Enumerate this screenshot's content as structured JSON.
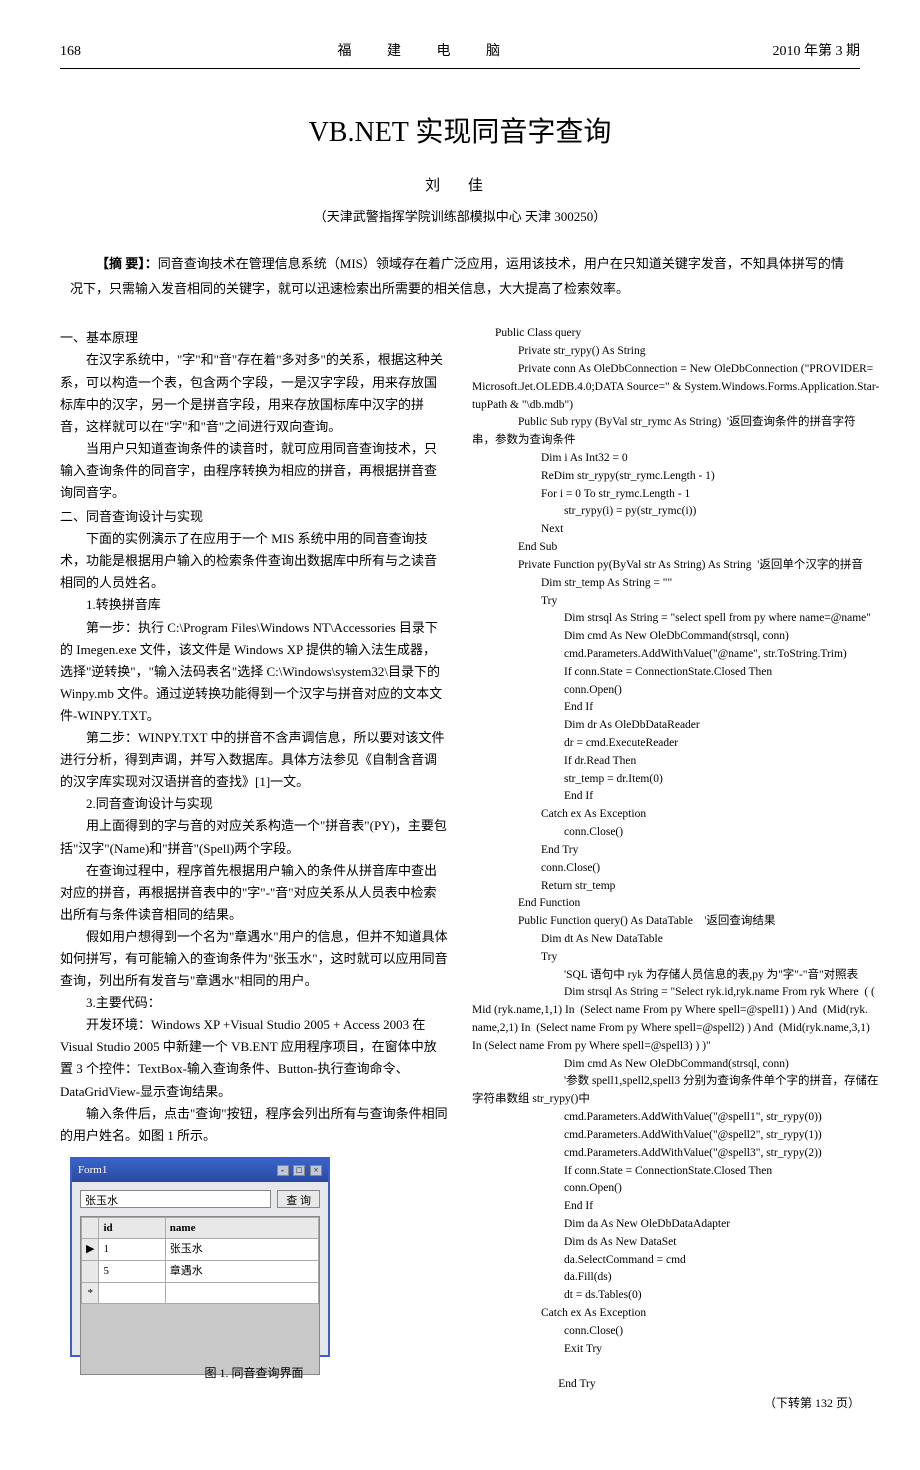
{
  "header": {
    "page_num": "168",
    "journal": "福 建 电 脑",
    "issue": "2010 年第 3 期"
  },
  "title": "VB.NET 实现同音字查询",
  "author": "刘 佳",
  "affiliation": "（天津武警指挥学院训练部模拟中心  天津  300250）",
  "abstract_label": "【摘  要】：",
  "abstract_body": "同音查询技术在管理信息系统（MIS）领域存在着广泛应用，运用该技术，用户在只知道关键字发音，不知具体拼写的情况下，只需输入发音相同的关键字，就可以迅速检索出所需要的相关信息，大大提高了检索效率。",
  "left": {
    "s1_head": "一、基本原理",
    "p1": "在汉字系统中，\"字\"和\"音\"存在着\"多对多\"的关系，根据这种关系，可以构造一个表，包含两个字段，一是汉字字段，用来存放国标库中的汉字，另一个是拼音字段，用来存放国标库中汉字的拼音，这样就可以在\"字\"和\"音\"之间进行双向查询。",
    "p2": "当用户只知道查询条件的读音时，就可应用同音查询技术，只输入查询条件的同音字，由程序转换为相应的拼音，再根据拼音查询同音字。",
    "s2_head": "二、同音查询设计与实现",
    "p3": "下面的实例演示了在应用于一个 MIS 系统中用的同音查询技术，功能是根据用户输入的检索条件查询出数据库中所有与之读音相同的人员姓名。",
    "sub1": "1.转换拼音库",
    "p4": "第一步：执行 C:\\Program Files\\Windows NT\\Accessories 目录下的 Imegen.exe 文件，该文件是 Windows XP 提供的输入法生成器，选择\"逆转换\"，\"输入法码表名\"选择 C:\\Windows\\system32\\目录下的 Winpy.mb 文件。通过逆转换功能得到一个汉字与拼音对应的文本文件-WINPY.TXT。",
    "p5": "第二步：WINPY.TXT 中的拼音不含声调信息，所以要对该文件进行分析，得到声调，并写入数据库。具体方法参见《自制含音调的汉字库实现对汉语拼音的查找》[1]一文。",
    "sub2": "2.同音查询设计与实现",
    "p6": "用上面得到的字与音的对应关系构造一个\"拼音表\"(PY)，主要包括\"汉字\"(Name)和\"拼音\"(Spell)两个字段。",
    "p7": "在查询过程中，程序首先根据用户输入的条件从拼音库中查出对应的拼音，再根据拼音表中的\"字\"-\"音\"对应关系从人员表中检索出所有与条件读音相同的结果。",
    "p8": "假如用户想得到一个名为\"章遇水\"用户的信息，但并不知道具体如何拼写，有可能输入的查询条件为\"张玉水\"，这时就可以应用同音查询，列出所有发音与\"章遇水\"相同的用户。",
    "sub3": "3.主要代码：",
    "p9": "开发环境：Windows XP +Visual Studio 2005 + Access 2003 在 Visual Studio 2005 中新建一个 VB.ENT 应用程序项目，在窗体中放置 3 个控件：TextBox-输入查询条件、Button-执行查询命令、DataGridView-显示查询结果。",
    "p10": "输入条件后，点击\"查询\"按钮，程序会列出所有与查询条件相同的用户姓名。如图 1 所示。"
  },
  "figure": {
    "win_title": "Form1",
    "input_value": "张玉水",
    "btn_label": "查 询",
    "col_id": "id",
    "col_name": "name",
    "row1_id": "1",
    "row1_name": "张玉水",
    "row2_id": "5",
    "row2_name": "章遇水",
    "caption": "图 1. 同音查询界面"
  },
  "code": {
    "l1": "Public Class query",
    "l2": "Private str_rypy() As String",
    "l3": "Private conn As OleDbConnection = New OleDbConnection (\"PROVIDER=",
    "l3b": "Microsoft.Jet.OLEDB.4.0;DATA Source=\" & System.Windows.Forms.Application.Star-",
    "l3c": "tupPath & \"\\db.mdb\")",
    "l4": "Public Sub rypy (ByVal str_rymc As String)  '返回查询条件的拼音字符",
    "l4b": "串，参数为查询条件",
    "l5": "Dim i As Int32 = 0",
    "l6": "ReDim str_rypy(str_rymc.Length - 1)",
    "l7": "For i = 0 To str_rymc.Length - 1",
    "l8": "str_rypy(i) = py(str_rymc(i))",
    "l9": "Next",
    "l10": "End Sub",
    "l11": "Private Function py(ByVal str As String) As String  '返回单个汉字的拼音",
    "l12": "Dim str_temp As String = \"\"",
    "l13": "Try",
    "l14": "Dim strsql As String = \"select spell from py where name=@name\"",
    "l15": "Dim cmd As New OleDbCommand(strsql, conn)",
    "l16": "cmd.Parameters.AddWithValue(\"@name\", str.ToString.Trim)",
    "l17": "If conn.State = ConnectionState.Closed Then",
    "l18": "conn.Open()",
    "l19": "End If",
    "l20": "Dim dr As OleDbDataReader",
    "l21": "dr = cmd.ExecuteReader",
    "l22": "If dr.Read Then",
    "l23": "str_temp = dr.Item(0)",
    "l24": "End If",
    "l25": "Catch ex As Exception",
    "l26": "conn.Close()",
    "l27": "End Try",
    "l28": "conn.Close()",
    "l29": "Return str_temp",
    "l30": "End Function",
    "l31": "Public Function query() As DataTable    '返回查询结果",
    "l32": "Dim dt As New DataTable",
    "l33": "Try",
    "l34": "'SQL 语句中 ryk 为存储人员信息的表,py 为\"字\"-\"音\"对照表",
    "l35": "Dim strsql As String = \"Select ryk.id,ryk.name From ryk Where  ( (",
    "l35b": "Mid (ryk.name,1,1) In  (Select name From py Where spell=@spell1) ) And  (Mid(ryk.",
    "l35c": "name,2,1) In  (Select name From py Where spell=@spell2) ) And  (Mid(ryk.name,3,1)",
    "l35d": "In (Select name From py Where spell=@spell3) ) )\"",
    "l36": "Dim cmd As New OleDbCommand(strsql, conn)",
    "l37": "'参数 spell1,spell2,spell3 分别为查询条件单个字的拼音，存储在",
    "l37b": "字符串数组 str_rypy()中",
    "l38": "cmd.Parameters.AddWithValue(\"@spell1\", str_rypy(0))",
    "l39": "cmd.Parameters.AddWithValue(\"@spell2\", str_rypy(1))",
    "l40": "cmd.Parameters.AddWithValue(\"@spell3\", str_rypy(2))",
    "l41": "If conn.State = ConnectionState.Closed Then",
    "l42": "conn.Open()",
    "l43": "End If",
    "l44": "Dim da As New OleDbDataAdapter",
    "l45": "Dim ds As New DataSet",
    "l46": "da.SelectCommand = cmd",
    "l47": "da.Fill(ds)",
    "l48": "dt = ds.Tables(0)",
    "l49": "Catch ex As Exception",
    "l50": "conn.Close()",
    "l51": "Exit Try",
    "l52": "End Try"
  },
  "page_ref": "（下转第 132 页）"
}
